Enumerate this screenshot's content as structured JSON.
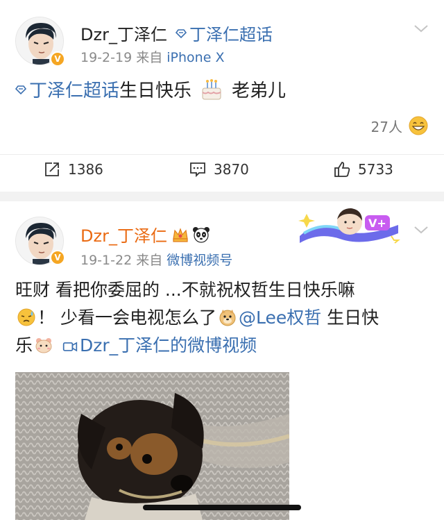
{
  "post1": {
    "username": "Dzr_丁泽仁",
    "topic": "丁泽仁超话",
    "date": "19-2-19",
    "source_prefix": "来自",
    "source": "iPhone X",
    "content_topic": "丁泽仁超话",
    "content_text_a": "生日快乐",
    "content_text_b": "老弟儿",
    "likers_count": "27人",
    "repost_count": "1386",
    "comment_count": "3870",
    "like_count": "5733"
  },
  "post2": {
    "username": "Dzr_丁泽仁",
    "date": "19-1-22",
    "source_prefix": "来自",
    "source": "微博视频号",
    "line1": "旺财 看把你委屈的 ...不就祝权哲生日快乐嘛",
    "line2a": "！ 少看一会电视怎么了",
    "mention": "@Lee权哲",
    "line2b": " 生日快",
    "line3a": "乐",
    "video_link": "Dzr_丁泽仁的微博视频"
  },
  "colors": {
    "link": "#3a6fb0",
    "vip_name": "#ea6a12",
    "verified_badge": "#f5a623"
  },
  "icons": [
    "diamond-icon",
    "chevron-down-icon",
    "cake-icon",
    "grin-icon",
    "repost-icon",
    "comment-icon",
    "like-icon",
    "crown-icon",
    "panda-icon",
    "sweat-icon",
    "doge-icon",
    "hamster-icon",
    "video-icon"
  ]
}
